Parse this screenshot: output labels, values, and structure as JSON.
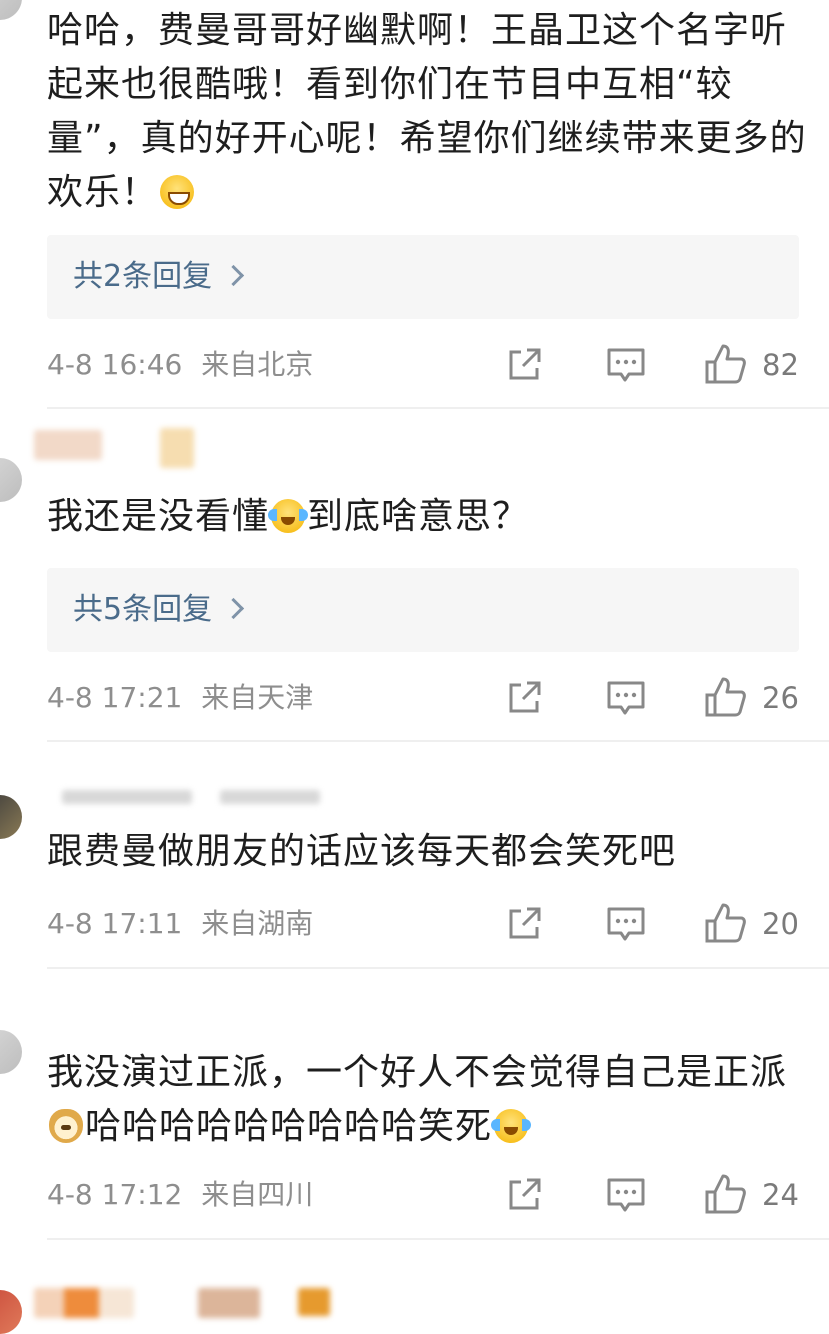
{
  "comments": [
    {
      "text_parts": [
        "哈哈，费曼哥哥好幽默啊！王晶卫这个名字听起来也很酷哦！看到你们在节目中互相“较量”，真的好开心呢！希望你们继续带来更多的欢乐！"
      ],
      "replies_label": "共2条回复",
      "time": "4-8 16:46",
      "location": "来自北京",
      "likes": "82"
    },
    {
      "text_parts": [
        "我还是没看懂",
        "到底啥意思？"
      ],
      "replies_label": "共5条回复",
      "time": "4-8 17:21",
      "location": "来自天津",
      "likes": "26"
    },
    {
      "text_parts": [
        "跟费曼做朋友的话应该每天都会笑死吧"
      ],
      "time": "4-8 17:11",
      "location": "来自湖南",
      "likes": "20"
    },
    {
      "text_parts": [
        "我没演过正派，一个好人不会觉得自己是正派",
        "哈哈哈哈哈哈哈哈哈笑死"
      ],
      "time": "4-8 17:12",
      "location": "来自四川",
      "likes": "24"
    }
  ],
  "icons": {
    "share": "share-icon",
    "comment": "comment-icon",
    "like": "thumbs-up-icon"
  },
  "colors": {
    "reply_link": "#4a6b8a",
    "meta_text": "#8e8e8e"
  }
}
